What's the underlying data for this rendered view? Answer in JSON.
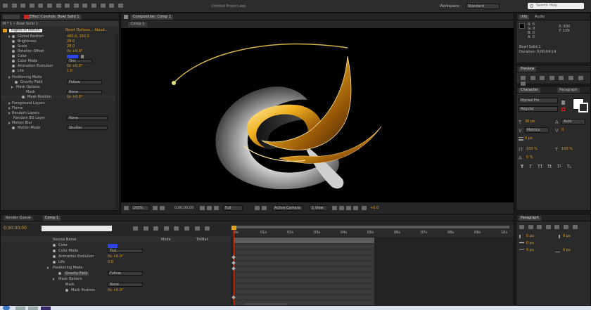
{
  "menubar": {
    "title": "Untitled Project.aep",
    "workspace_label": "Workspace:",
    "workspace_value": "Standard",
    "search_placeholder": "Search Help"
  },
  "effect_controls": {
    "tab_label": "Effect Controls: Bowl Solid 1",
    "layer_label": "M * 1 • Bowl Solid 1",
    "effect_name": "Rights of Motion",
    "effect_links": "Reset   Options...   About...",
    "props": [
      {
        "name": "Global Position",
        "value": "480.0, 350.0"
      },
      {
        "name": "Brightness",
        "value": "28.0"
      },
      {
        "name": "Scale",
        "value": "28.0"
      },
      {
        "name": "Rotation Offset",
        "value": "0x +0.0°"
      },
      {
        "name": "Color",
        "value": ""
      },
      {
        "name": "Color Mode",
        "value": "Tint"
      },
      {
        "name": "Animation Evolution",
        "value": "0x +0.0°"
      },
      {
        "name": "Life",
        "value": "1.0"
      },
      {
        "name": "Positioning Mode",
        "value": ""
      },
      {
        "name": "Gravity Field",
        "value": "Follow"
      },
      {
        "name": "Mask Options",
        "value": ""
      },
      {
        "name": "Mask",
        "value": "None"
      },
      {
        "name": "Mask Position",
        "value": "0x +0.0°"
      },
      {
        "name": "Foreground Layers",
        "value": ""
      },
      {
        "name": "Flame",
        "value": ""
      },
      {
        "name": "Random Layers",
        "value": ""
      },
      {
        "name": "Random BG Layer",
        "value": "None"
      },
      {
        "name": "Motion Blur",
        "value": ""
      },
      {
        "name": "Motion Mode",
        "value": "Shutter"
      }
    ]
  },
  "composition": {
    "tab_label": "Composition: Comp 1",
    "crumb": "Comp 1",
    "zoom": "100%",
    "timecode": "0;00;00;00",
    "quality": "Full",
    "camera": "Active Camera",
    "views": "1 View",
    "exposure": "+0.0"
  },
  "info": {
    "tab_label": "Info",
    "audio_tab": "Audio",
    "r": "R: 0",
    "g": "G: 0",
    "b": "B: 0",
    "a": "A: 0",
    "x": "X: 830",
    "y": "Y: 129",
    "layer_name": "Bowl Solid 1",
    "duration": "Duration: 0;00;04;14"
  },
  "preview": {
    "tab_label": "Preview"
  },
  "character": {
    "tab_label": "Character",
    "paragraph_tab": "Paragraph",
    "font_name": "Myriad Pro",
    "font_style": "Regular",
    "size": "36 px",
    "leading": "Auto",
    "tracking": "0",
    "kerning": "Metrics",
    "vscale": "100 %",
    "hscale": "100 %",
    "baseline": "0 px",
    "tsume": "0 %"
  },
  "timeline": {
    "tab_label": "Comp 1",
    "render_tab": "Render Queue",
    "timecode": "0;00;00;00",
    "search_placeholder": "",
    "col_source": "Source Name",
    "col_mode": "Mode",
    "col_trkmat": "TrkMat",
    "rows": [
      {
        "name": "Color",
        "value": ""
      },
      {
        "name": "Color Mode",
        "value": "Tint"
      },
      {
        "name": "Animation Evolution",
        "value": "0x +0.0°"
      },
      {
        "name": "Life",
        "value": "0.0"
      },
      {
        "name": "Positioning Mode",
        "value": ""
      },
      {
        "name": "Gravity Field",
        "value": "Follow"
      },
      {
        "name": "Mask Options",
        "value": ""
      },
      {
        "name": "Mask",
        "value": "None"
      },
      {
        "name": "Mask Position",
        "value": "0x +0.0°"
      }
    ],
    "ruler_labels": [
      "0s",
      "01s",
      "02s",
      "03s",
      "04s",
      "05s",
      "06s",
      "07s",
      "08s",
      "09s",
      "10s"
    ]
  },
  "paragraph": {
    "tab_label": "Paragraph",
    "indent_left": "0 px",
    "indent_right": "0 px",
    "first_line": "0 px",
    "space_before": "0 px",
    "space_after": "0 px"
  },
  "colors": {
    "accent": "#e0a020",
    "color_swatch": "#2f44e6",
    "work_area": "#5b5b5b"
  }
}
